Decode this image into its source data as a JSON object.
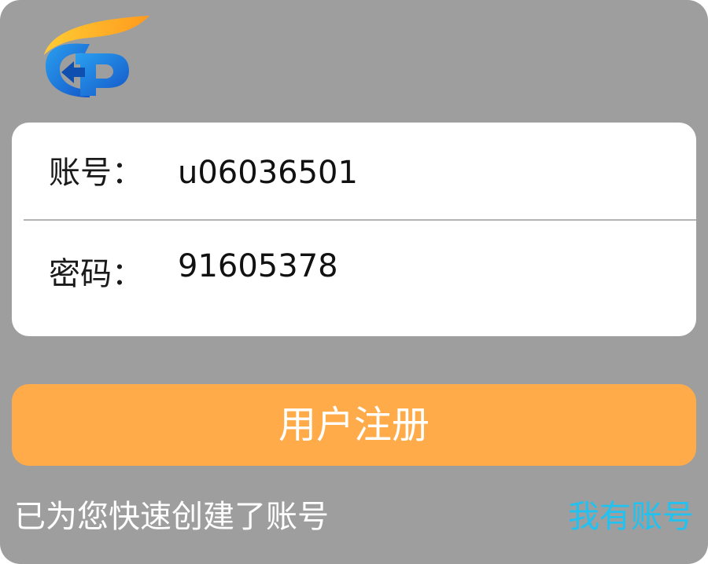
{
  "form": {
    "account_label": "账号：",
    "account_value": "u06036501",
    "password_label": "密码：",
    "password_value": "91605378"
  },
  "register_button": {
    "label": "用户注册"
  },
  "footer": {
    "status_text": "已为您快速创建了账号",
    "have_account_link": "我有账号"
  },
  "icons": {
    "logo": "app-logo-icon"
  },
  "colors": {
    "overlay_background": "#9e9e9e",
    "card_background": "#ffffff",
    "register_button": "#ffab4a",
    "link_text": "#1fc2f0",
    "logo_orange": "#ffb22e",
    "logo_blue": "#1f78d8"
  }
}
